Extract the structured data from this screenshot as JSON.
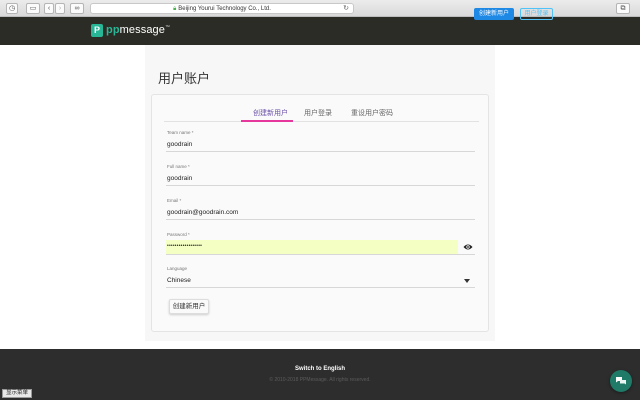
{
  "browser": {
    "url": "Beijing Yourui Technology Co., Ltd.",
    "back_glyph": "‹",
    "forward_glyph": "›"
  },
  "header": {
    "logo_mark": "P",
    "logo_pp": "pp",
    "logo_rest": "message",
    "logo_tm": "™",
    "create_user_label": "创建新用户",
    "login_label": "用户登录"
  },
  "page": {
    "title": "用户账户"
  },
  "tabs": [
    {
      "label": "创建新用户",
      "active": true
    },
    {
      "label": "用户登录",
      "active": false
    },
    {
      "label": "重设用户密码",
      "active": false
    }
  ],
  "form": {
    "team_name_label": "Team name *",
    "team_name_value": "goodrain",
    "full_name_label": "Full name *",
    "full_name_value": "goodrain",
    "email_label": "Email *",
    "email_value": "goodrain@goodrain.com",
    "password_label": "Password *",
    "password_value": "••••••••••••••••••",
    "language_label": "Language",
    "language_value": "Chinese",
    "submit_label": "创建新用户"
  },
  "footer": {
    "switch_language": "Switch to English",
    "copyright": "© 2010-2018 PPMessage. All rights reserved.",
    "show_menu": "显示菜单"
  },
  "colors": {
    "header_bg": "#2b2c26",
    "brand_green": "#27b796",
    "primary_blue": "#1e88e5",
    "tab_active": "#6a4fa8",
    "tab_underline": "#e6379c",
    "autofill_bg": "#f4ffc4",
    "footer_bg": "#2d2d2d"
  },
  "icons": {
    "password_toggle": "eye-icon",
    "language_select": "caret-down-icon",
    "chat": "chat-icon",
    "lock": "lock-icon",
    "reload": "reload-icon"
  }
}
